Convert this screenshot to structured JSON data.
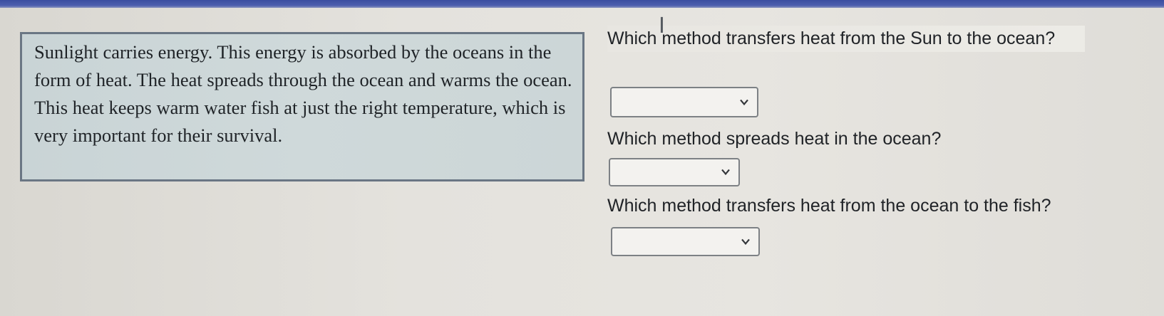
{
  "passage": {
    "text": "Sunlight carries energy. This energy is absorbed by the oceans in the form of heat. The heat spreads through the ocean and warms the ocean. This heat keeps warm water fish at just the right temperature, which is very important for their survival."
  },
  "questions": [
    {
      "text": "Which method transfers heat from the Sun to the ocean?",
      "selected": ""
    },
    {
      "text": "Which method spreads heat in the ocean?",
      "selected": ""
    },
    {
      "text": "Which method transfers heat from the ocean to the fish?",
      "selected": ""
    }
  ],
  "icons": {
    "dropdown_arrow": "chevron-down-icon",
    "cursor": "text-cursor-icon"
  },
  "colors": {
    "top_bar": "#3b4ea0",
    "passage_bg": "#ccd6d7",
    "passage_border": "#6a7684",
    "page_bg": "#e4e2dd"
  }
}
